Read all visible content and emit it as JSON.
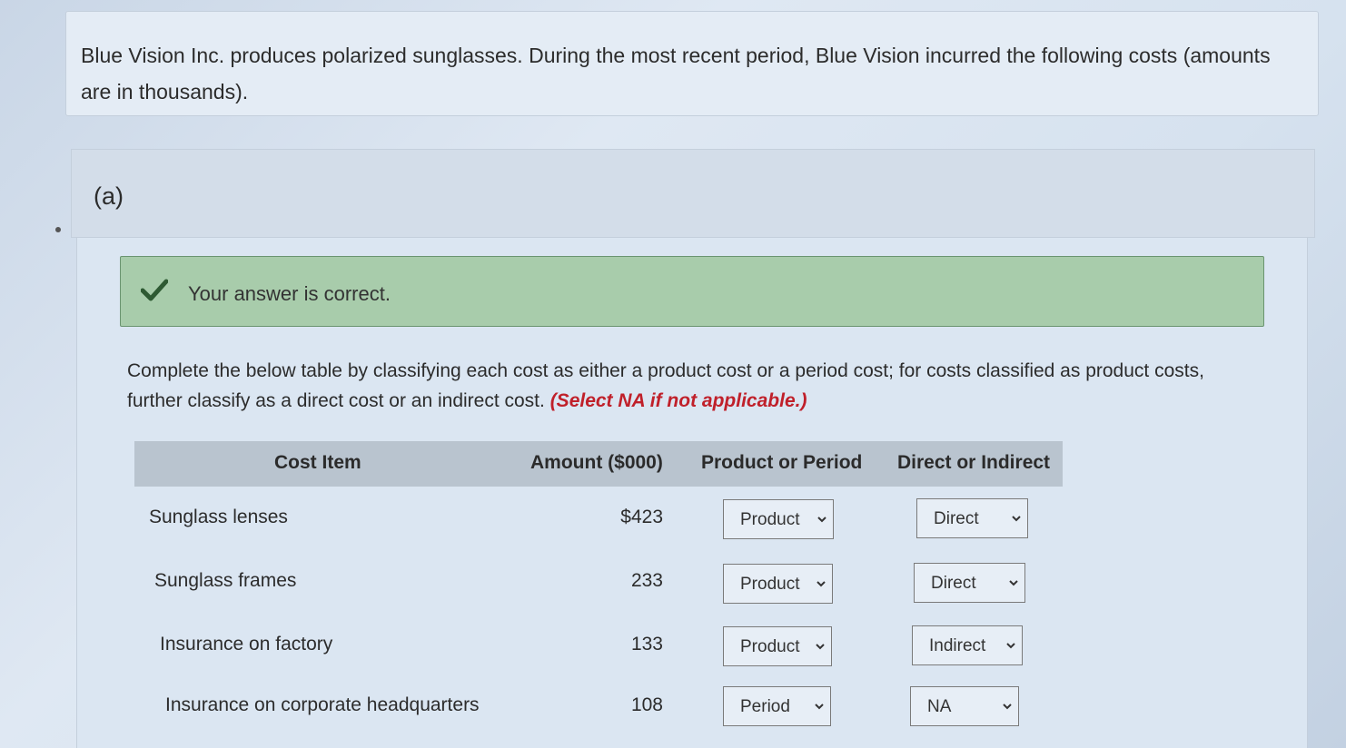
{
  "intro": {
    "text": "Blue Vision Inc. produces polarized sunglasses. During the most recent period, Blue Vision incurred the following costs (amounts are in thousands)."
  },
  "part": {
    "label": "(a)"
  },
  "feedback": {
    "message": "Your answer is correct.",
    "icon": "checkmark-icon",
    "color": "#a8ccab"
  },
  "instructions": {
    "text": "Complete the below table by classifying each cost as either a product cost or a period cost; for costs classified as product costs, further classify as a direct cost or an indirect cost. ",
    "note": "(Select NA if not applicable.)",
    "note_color": "#c0202a"
  },
  "table": {
    "headers": {
      "item": "Cost Item",
      "amount": "Amount ($000)",
      "product_or_period": "Product or Period",
      "direct_or_indirect": "Direct or Indirect"
    },
    "rows": [
      {
        "item": "Sunglass lenses",
        "amount": "$423",
        "product_or_period": "Product",
        "direct_or_indirect": "Direct"
      },
      {
        "item": "Sunglass frames",
        "amount": "233",
        "product_or_period": "Product",
        "direct_or_indirect": "Direct"
      },
      {
        "item": "Insurance on factory",
        "amount": "133",
        "product_or_period": "Product",
        "direct_or_indirect": "Indirect"
      },
      {
        "item": "Insurance on corporate headquarters",
        "amount": "108",
        "product_or_period": "Period",
        "direct_or_indirect": "NA"
      }
    ]
  }
}
